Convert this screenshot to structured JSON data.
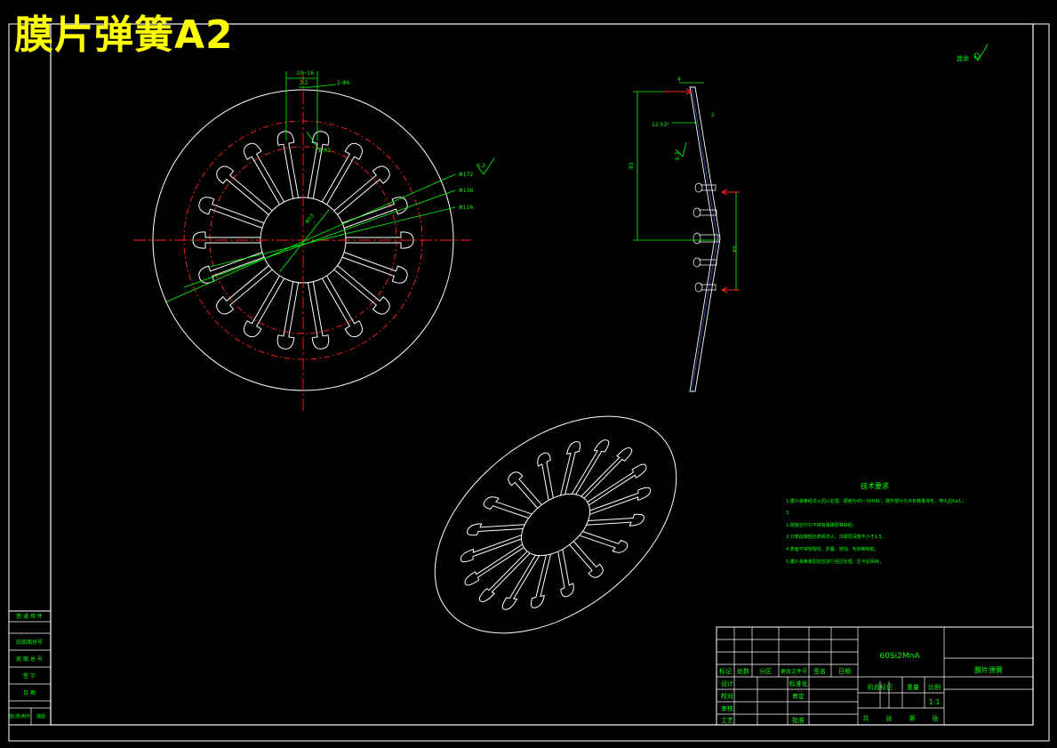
{
  "banner": {
    "title": "膜片弹簧A2"
  },
  "roughness_note": "其余",
  "front_view": {
    "dims": {
      "slot_width_top": "10~16",
      "slot_inner": "3.2",
      "hole_spec": "2-Φ6",
      "slot_spec": "2-R2",
      "d_outer": "Φ172",
      "d_mid": "Φ136",
      "d_inner": "Φ116",
      "d_center": "Φ53",
      "roughness": "6.3"
    }
  },
  "side_view": {
    "dims": {
      "thickness": "4",
      "edge": "2",
      "angle": "12.53°",
      "roughness": "6.3",
      "height": "85",
      "pivot": "54"
    }
  },
  "tech_notes": {
    "title": "技术要求",
    "lines": [
      "1.膜片弹簧经淬火回火处理，硬度为45~50HRC，碟形部分允许有微量变形，喷丸后Ra3.2~",
      "3.",
      "2.硬度应均匀不得有脱碳层等缺陷。",
      "3.分离指端部应高频淬火，淬硬层深度不小于1.5。",
      "4.表面不得有裂纹、折叠、锈蚀、毛刺等缺陷。",
      "5.膜片弹簧装配前应进行强压处理，压平后保持。"
    ]
  },
  "side_table": {
    "rows": [
      "借 通 用 件",
      "旧底图总号",
      "底 图 总 号",
      "签    字",
      "日    期",
      "借(通)用件",
      "描图"
    ]
  },
  "title_block": {
    "material": "60Si2MnA",
    "part_name": "膜片弹簧",
    "headers": [
      "标记",
      "处数",
      "分区",
      "更改文件号",
      "签名",
      "日期"
    ],
    "roles": [
      "设计",
      "校对",
      "审核",
      "工艺"
    ],
    "roles2": [
      "标准化",
      "审定",
      "批准"
    ],
    "meta_labels": [
      "阶段标记",
      "重量",
      "比例"
    ],
    "scale": "1:1",
    "sheet_labels": [
      "共",
      "张",
      "第",
      "张"
    ]
  }
}
